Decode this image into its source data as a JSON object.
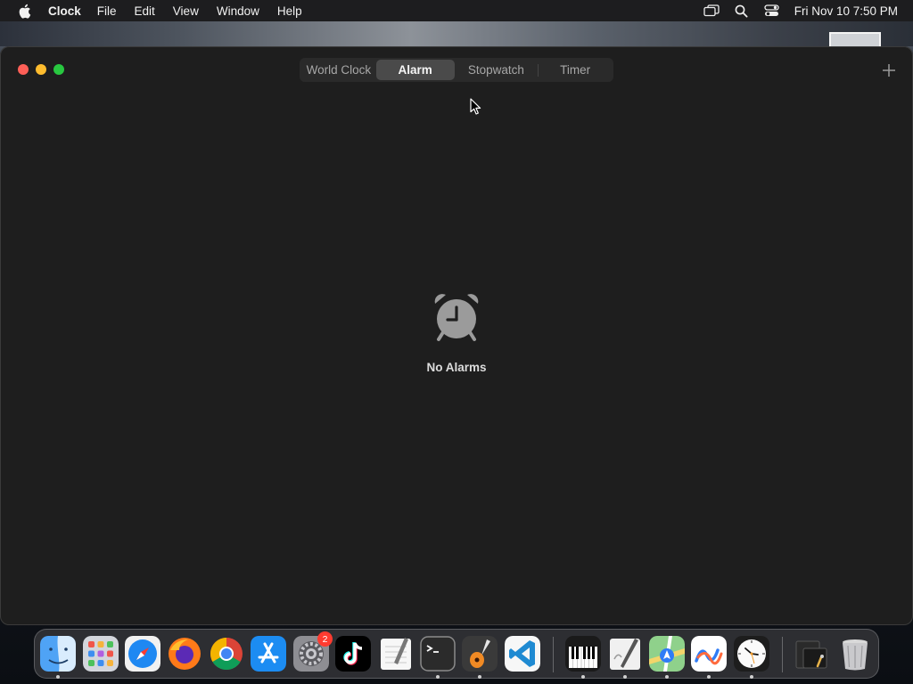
{
  "menubar": {
    "app_name": "Clock",
    "items": [
      "File",
      "Edit",
      "View",
      "Window",
      "Help"
    ],
    "datetime": "Fri Nov 10  7:50 PM"
  },
  "window": {
    "tabs": [
      {
        "label": "World Clock",
        "selected": false
      },
      {
        "label": "Alarm",
        "selected": true
      },
      {
        "label": "Stopwatch",
        "selected": false
      },
      {
        "label": "Timer",
        "selected": false
      }
    ],
    "empty_state": "No Alarms"
  },
  "dock": {
    "apps": [
      "Finder",
      "Launchpad",
      "Safari",
      "Firefox",
      "Google Chrome",
      "App Store",
      "System Settings",
      "TikTok",
      "TextEdit",
      "Terminal",
      "GarageBand",
      "Visual Studio Code",
      "Piano",
      "Script Editor",
      "Maps",
      "Freeform",
      "Clock",
      "Downloads stack",
      "Trash"
    ],
    "settings_badge": "2"
  },
  "colors": {
    "window_bg": "#1e1e1e",
    "selected_tab": "#4a4a4a",
    "close": "#fe5f57",
    "minimize": "#febc2e",
    "zoom": "#28c840",
    "alarm_icon": "#9b9b9b"
  }
}
